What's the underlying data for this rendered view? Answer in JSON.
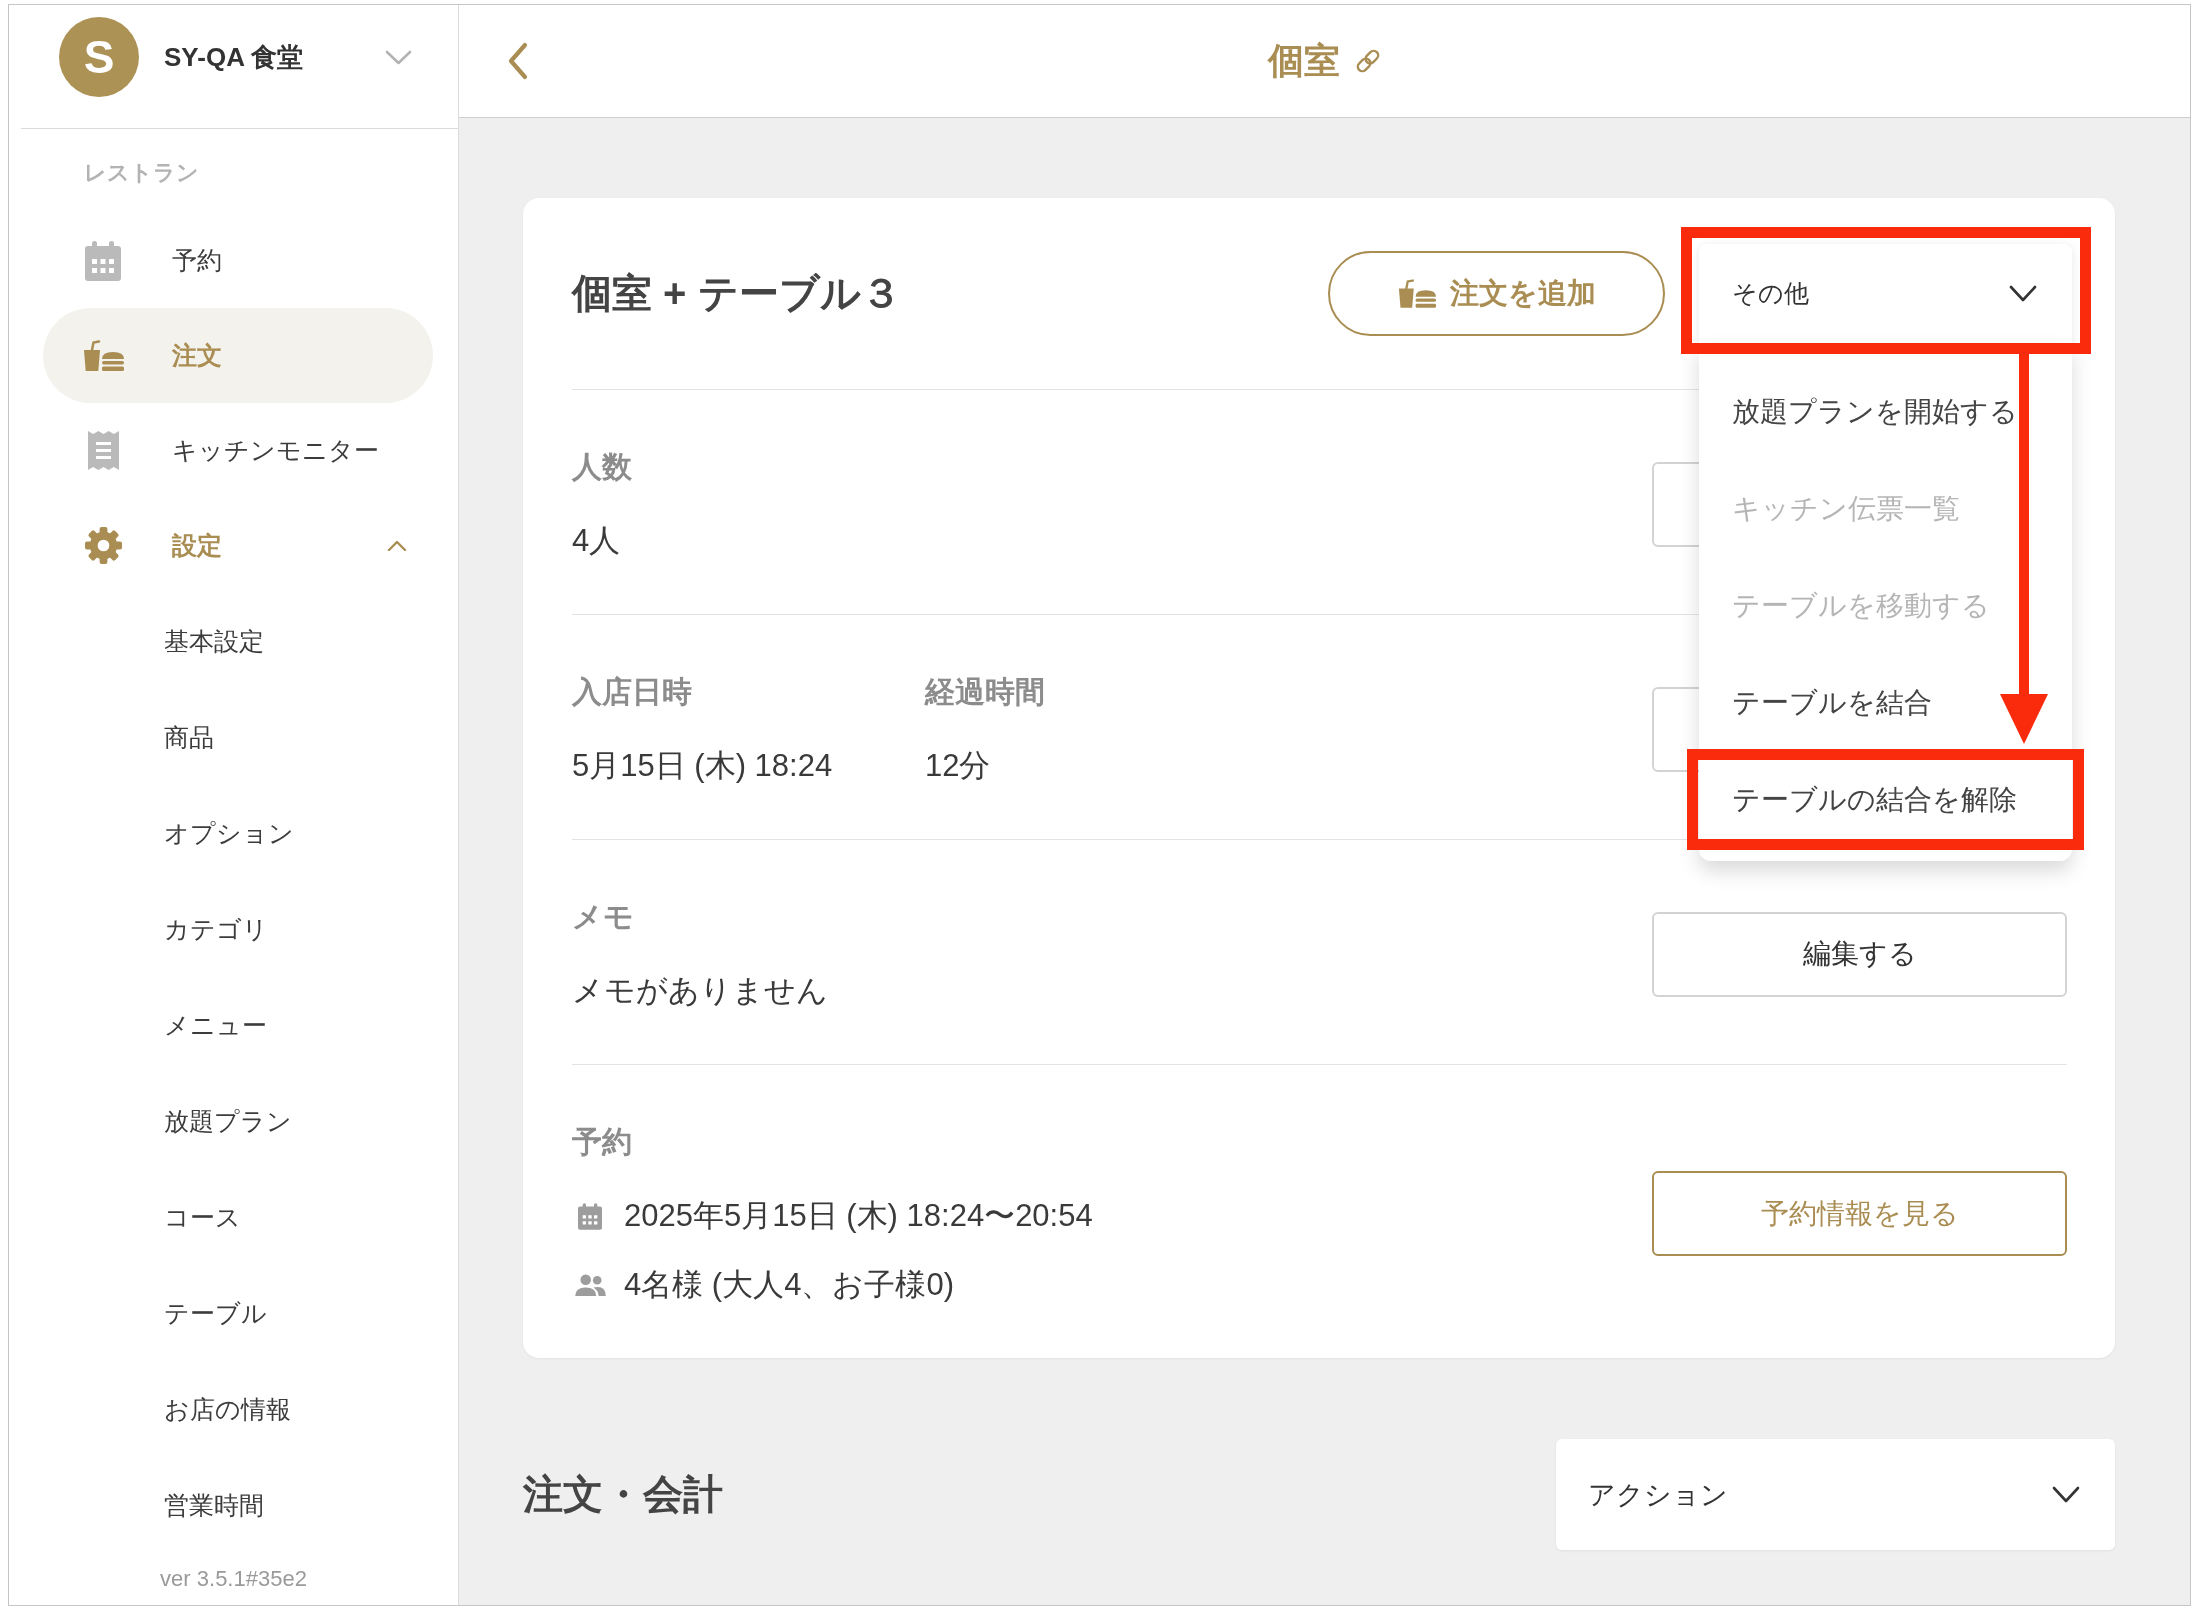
{
  "sidebar": {
    "store": {
      "avatar_letter": "S",
      "name": "SY-QA 食堂"
    },
    "section_label": "レストラン",
    "items": [
      {
        "label": "予約",
        "selected": false
      },
      {
        "label": "注文",
        "selected": true
      },
      {
        "label": "キッチンモニター",
        "selected": false
      },
      {
        "label": "設定",
        "selected": false,
        "expanded": true,
        "children": [
          {
            "label": "基本設定",
            "selected": false
          },
          {
            "label": "商品",
            "selected": false
          },
          {
            "label": "オプション",
            "selected": false
          },
          {
            "label": "カテゴリ",
            "selected": false
          },
          {
            "label": "メニュー",
            "selected": false
          },
          {
            "label": "放題プラン",
            "selected": false
          },
          {
            "label": "コース",
            "selected": false
          },
          {
            "label": "テーブル",
            "selected": false
          },
          {
            "label": "お店の情報",
            "selected": false
          },
          {
            "label": "営業時間",
            "selected": false
          }
        ]
      }
    ],
    "version": "ver 3.5.1#35e2"
  },
  "header": {
    "title": "個室"
  },
  "card": {
    "title": "個室 + テーブル３",
    "add_order_button": {
      "label": "注文を追加"
    },
    "more_select": {
      "value": "その他",
      "expanded": true,
      "highlighted": true,
      "options": [
        {
          "label": "放題プランを開始する",
          "disabled": false,
          "highlighted": false
        },
        {
          "label": "キッチン伝票一覧",
          "disabled": true,
          "highlighted": false
        },
        {
          "label": "テーブルを移動する",
          "disabled": true,
          "highlighted": false
        },
        {
          "label": "テーブルを結合",
          "disabled": false,
          "highlighted": false
        },
        {
          "label": "テーブルの結合を解除",
          "disabled": false,
          "highlighted": true
        }
      ]
    },
    "sections": [
      {
        "kind": "fields",
        "fields": [
          {
            "label": "人数",
            "value": "4人"
          }
        ],
        "button": {
          "kind": "plain"
        }
      },
      {
        "kind": "fields",
        "fields": [
          {
            "label": "入店日時",
            "value": "5月15日 (木) 18:24"
          },
          {
            "label": "経過時間",
            "value": "12分"
          }
        ],
        "button": {
          "kind": "plain"
        }
      },
      {
        "kind": "fields",
        "fields": [
          {
            "label": "メモ",
            "value": "メモがありません"
          }
        ],
        "button": {
          "kind": "plain",
          "label": "編集する"
        }
      },
      {
        "kind": "reservation",
        "label": "予約",
        "lines": [
          "2025年5月15日 (木) 18:24〜20:54",
          "4名様 (大人4、お子様0)"
        ],
        "button": {
          "kind": "accent",
          "label": "予約情報を見る"
        }
      }
    ]
  },
  "orders": {
    "title": "注文・会計",
    "action_select": {
      "value": "アクション",
      "expanded": false
    }
  }
}
